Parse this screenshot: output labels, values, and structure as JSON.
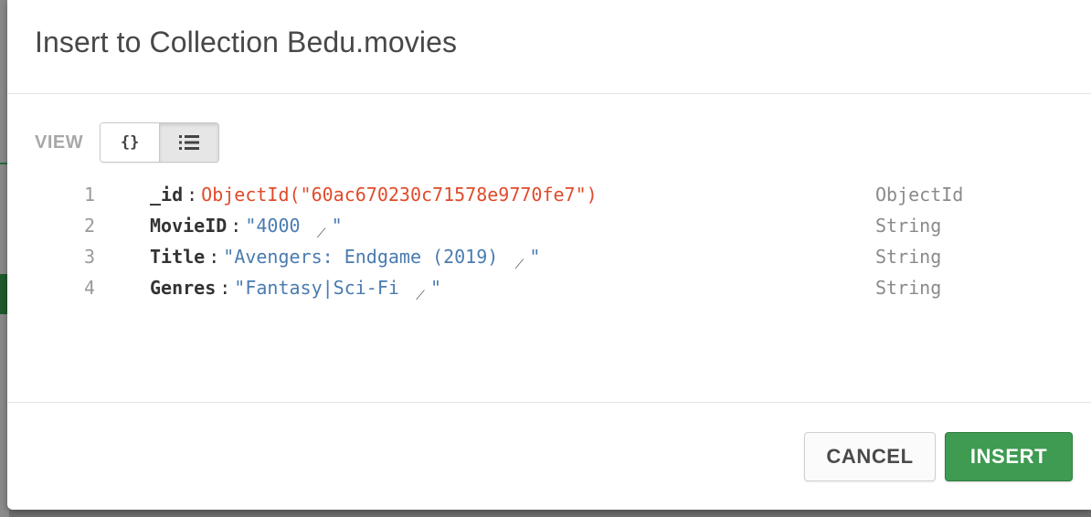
{
  "modal": {
    "title": "Insert to Collection Bedu.movies"
  },
  "view": {
    "label": "VIEW",
    "buttons": [
      {
        "name": "json-view",
        "glyph": "{}",
        "active": false
      },
      {
        "name": "list-view",
        "glyph": "list-icon",
        "active": true
      }
    ]
  },
  "document": {
    "fields": [
      {
        "line": "1",
        "key": "_id",
        "value": "ObjectId(\"60ac670230c71578e9770fe7\")",
        "type": "ObjectId",
        "kind": "objectid"
      },
      {
        "line": "2",
        "key": "MovieID",
        "value": "4000 ",
        "type": "String",
        "kind": "string"
      },
      {
        "line": "3",
        "key": "Title",
        "value": "Avengers: Endgame (2019) ",
        "type": "String",
        "kind": "string"
      },
      {
        "line": "4",
        "key": "Genres",
        "value": "Fantasy|Sci-Fi ",
        "type": "String",
        "kind": "string"
      }
    ]
  },
  "footer": {
    "cancel_label": "CANCEL",
    "insert_label": "INSERT"
  },
  "colors": {
    "insert_button": "#3f9a52",
    "objectid_value": "#e04b2b",
    "string_value": "#4a7bb0"
  }
}
